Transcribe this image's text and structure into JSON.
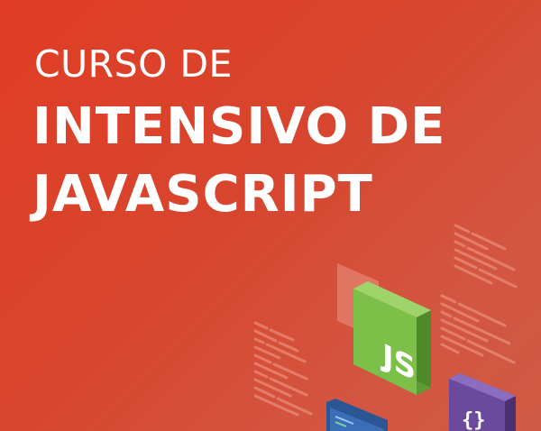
{
  "banner": {
    "title_line_1": "CURSO DE",
    "title_line_2": "INTENSIVO DE",
    "title_line_3": "JAVASCRIPT"
  },
  "illustration": {
    "js_badge_text": "JS",
    "braces_badge_text": "{}",
    "js_badge_icon": "javascript-logo-icon",
    "braces_badge_icon": "curly-braces-icon",
    "monitor_icon": "code-editor-monitor-icon"
  },
  "colors": {
    "background_start": "#e03d24",
    "background_end": "#cf5a45",
    "js_badge": "#7cc04a",
    "braces_badge": "#6b4a9e",
    "monitor": "#3a6fb8",
    "text": "#ffffff"
  }
}
